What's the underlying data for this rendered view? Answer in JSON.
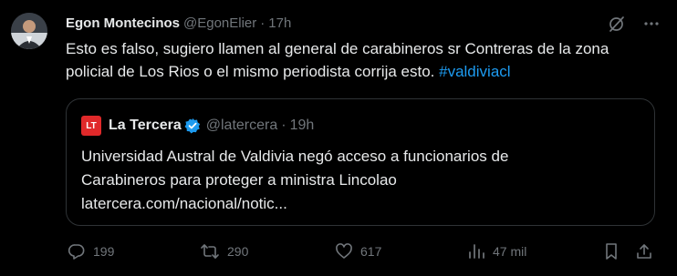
{
  "author": {
    "name": "Egon Montecinos",
    "handle": "@EgonElier",
    "separator": "·",
    "time": "17h"
  },
  "tweet": {
    "text": "Esto es falso, sugiero llamen al general de carabineros sr Contreras de la zona policial de Los Rios o el mismo periodista corrija esto. ",
    "hashtag": "#valdiviacl"
  },
  "quote": {
    "logo_text": "LT",
    "name": "La Tercera",
    "handle": "@latercera",
    "separator": "·",
    "time": "19h",
    "line1": "Universidad Austral de Valdivia negó acceso a funcionarios de",
    "line2": "Carabineros para proteger a ministra Lincolao",
    "link": "latercera.com/nacional/notic..."
  },
  "actions": {
    "replies": "199",
    "reposts": "290",
    "likes": "617",
    "views": "47 mil"
  },
  "colors": {
    "background": "#000000",
    "text": "#e7e9ea",
    "muted": "#71767b",
    "accent": "#1d9bf0",
    "border": "#2f3336",
    "logo": "#e0292a"
  },
  "icons": [
    "grok-icon",
    "more-icon",
    "verified-badge-icon",
    "reply-icon",
    "repost-icon",
    "like-icon",
    "views-icon",
    "bookmark-icon",
    "share-icon"
  ]
}
